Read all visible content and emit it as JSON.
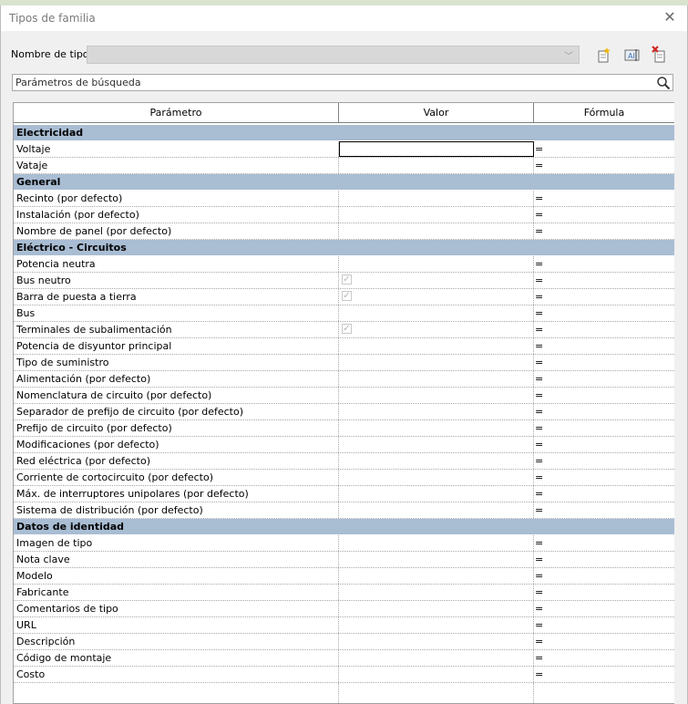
{
  "window": {
    "title": "Tipos de familia"
  },
  "type_row": {
    "label": "Nombre de tipo:",
    "value": ""
  },
  "search": {
    "placeholder": "Parámetros de búsqueda"
  },
  "columns": {
    "param": "Parámetro",
    "value": "Valor",
    "formula": "Fórmula"
  },
  "groups": [
    {
      "name": "Electricidad",
      "rows": [
        {
          "param": "Voltaje",
          "formula": "=",
          "selected": true
        },
        {
          "param": "Vataje",
          "formula": "="
        }
      ]
    },
    {
      "name": "General",
      "rows": [
        {
          "param": "Recinto (por defecto)",
          "formula": "="
        },
        {
          "param": "Instalación (por defecto)",
          "formula": "="
        },
        {
          "param": "Nombre de panel (por defecto)",
          "formula": "="
        }
      ]
    },
    {
      "name": "Eléctrico - Circuitos",
      "rows": [
        {
          "param": "Potencia neutra",
          "formula": "="
        },
        {
          "param": "Bus neutro",
          "formula": "=",
          "checkbox": true
        },
        {
          "param": "Barra de puesta a tierra",
          "formula": "=",
          "checkbox": true
        },
        {
          "param": "Bus",
          "formula": "="
        },
        {
          "param": "Terminales de subalimentación",
          "formula": "=",
          "checkbox": true
        },
        {
          "param": "Potencia de disyuntor principal",
          "formula": "="
        },
        {
          "param": "Tipo de suministro",
          "formula": "="
        },
        {
          "param": "Alimentación (por defecto)",
          "formula": "="
        },
        {
          "param": "Nomenclatura de circuito (por defecto)",
          "formula": "="
        },
        {
          "param": "Separador de prefijo de circuito (por defecto)",
          "formula": "="
        },
        {
          "param": "Prefijo de circuito (por defecto)",
          "formula": "="
        },
        {
          "param": "Modificaciones (por defecto)",
          "formula": "="
        },
        {
          "param": "Red eléctrica (por defecto)",
          "formula": "="
        },
        {
          "param": "Corriente de cortocircuito (por defecto)",
          "formula": "="
        },
        {
          "param": "Máx. de interruptores unipolares (por defecto)",
          "formula": "="
        },
        {
          "param": "Sistema de distribución (por defecto)",
          "formula": "="
        }
      ]
    },
    {
      "name": "Datos de identidad",
      "rows": [
        {
          "param": "Imagen de tipo",
          "formula": "="
        },
        {
          "param": "Nota clave",
          "formula": "="
        },
        {
          "param": "Modelo",
          "formula": "="
        },
        {
          "param": "Fabricante",
          "formula": "="
        },
        {
          "param": "Comentarios de tipo",
          "formula": "="
        },
        {
          "param": "URL",
          "formula": "="
        },
        {
          "param": "Descripción",
          "formula": "="
        },
        {
          "param": "Código de montaje",
          "formula": "="
        },
        {
          "param": "Costo",
          "formula": "="
        }
      ]
    }
  ],
  "icons": {
    "new_type": "new-type-icon",
    "rename_type": "rename-type-icon",
    "delete_type": "delete-type-icon",
    "search": "search-icon",
    "close": "close-icon"
  },
  "colors": {
    "group_header": "#a9bdd3",
    "dialog_bg": "#f0f0f0"
  }
}
